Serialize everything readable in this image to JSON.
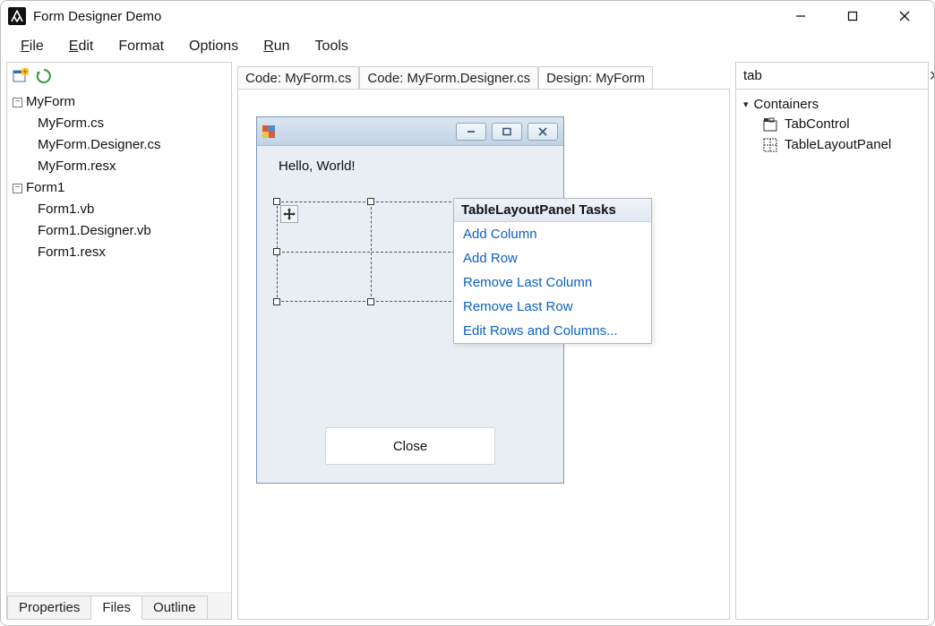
{
  "window": {
    "title": "Form Designer Demo"
  },
  "menubar": {
    "items": [
      "File",
      "Edit",
      "Format",
      "Options",
      "Run",
      "Tools"
    ],
    "underline": [
      true,
      true,
      false,
      false,
      true,
      false
    ]
  },
  "left": {
    "tree": [
      {
        "label": "MyForm",
        "expanded": true,
        "children": [
          "MyForm.cs",
          "MyForm.Designer.cs",
          "MyForm.resx"
        ]
      },
      {
        "label": "Form1",
        "expanded": true,
        "children": [
          "Form1.vb",
          "Form1.Designer.vb",
          "Form1.resx"
        ]
      }
    ],
    "bottom_tabs": [
      "Properties",
      "Files",
      "Outline"
    ],
    "active_bottom_tab": 1
  },
  "editor_tabs": {
    "items": [
      "Code: MyForm.cs",
      "Code: MyForm.Designer.cs",
      "Design: MyForm"
    ],
    "active": 2
  },
  "designed_form": {
    "label_text": "Hello, World!",
    "close_button": "Close"
  },
  "task_panel": {
    "title": "TableLayoutPanel Tasks",
    "items": [
      "Add Column",
      "Add Row",
      "Remove Last Column",
      "Remove Last Row",
      "Edit Rows and Columns..."
    ]
  },
  "right": {
    "search_value": "tab",
    "category": "Containers",
    "items": [
      "TabControl",
      "TableLayoutPanel"
    ]
  }
}
